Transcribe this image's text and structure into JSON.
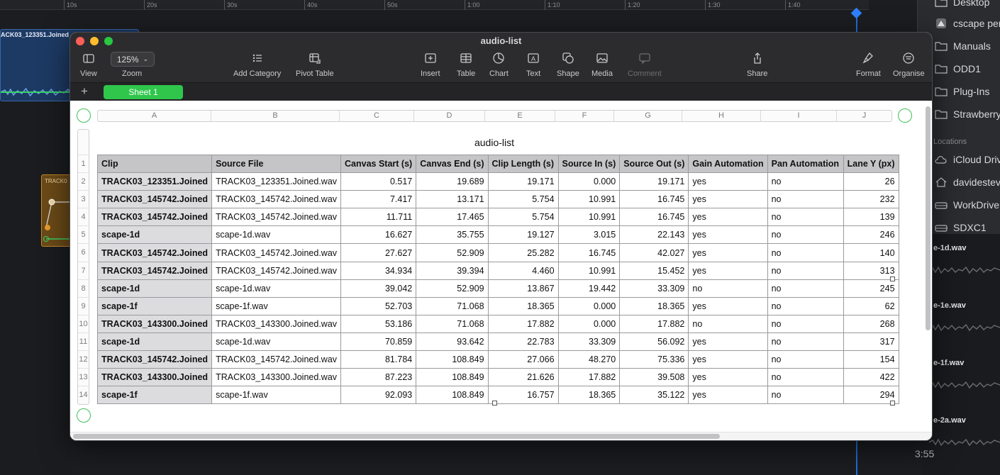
{
  "daw": {
    "ruler_ticks": [
      "10s",
      "20s",
      "30s",
      "40s",
      "50s",
      "1:00",
      "1:10",
      "1:20",
      "1:30",
      "1:40"
    ],
    "clip_name": "ACK03_123351.Joined",
    "clip2_name": "TRACK0",
    "time_readout": "3:55",
    "right_tracks": [
      "e-1d.wav",
      "e-1e.wav",
      "e-1f.wav",
      "e-2a.wav"
    ]
  },
  "finder": {
    "items": [
      {
        "label": "Desktop",
        "icon": "folder-icon"
      },
      {
        "label": "cscape per",
        "icon": "app-icon"
      },
      {
        "label": "Manuals",
        "icon": "folder-icon"
      },
      {
        "label": "ODD1",
        "icon": "folder-icon"
      },
      {
        "label": "Plug-Ins",
        "icon": "folder-icon"
      },
      {
        "label": "Strawberry",
        "icon": "folder-icon"
      }
    ],
    "section": "Locations",
    "locations": [
      {
        "label": "iCloud Drive",
        "icon": "cloud-icon"
      },
      {
        "label": "davidesteve",
        "icon": "home-icon"
      },
      {
        "label": "WorkDrive",
        "icon": "drive-icon"
      },
      {
        "label": "SDXC1",
        "icon": "drive-icon"
      }
    ]
  },
  "window": {
    "title": "audio-list",
    "toolbar": {
      "view": "View",
      "zoom_value": "125%",
      "zoom": "Zoom",
      "add_category": "Add Category",
      "pivot_table": "Pivot Table",
      "insert": "Insert",
      "table": "Table",
      "chart": "Chart",
      "text": "Text",
      "shape": "Shape",
      "media": "Media",
      "comment": "Comment",
      "share": "Share",
      "format": "Format",
      "organise": "Organise"
    },
    "add_sheet": "+",
    "sheet_tab": "Sheet 1"
  },
  "sheet": {
    "table_title": "audio-list",
    "column_letters": [
      "A",
      "B",
      "C",
      "D",
      "E",
      "F",
      "G",
      "H",
      "I",
      "J"
    ],
    "row_numbers": [
      "1",
      "2",
      "3",
      "4",
      "5",
      "6",
      "7",
      "8",
      "9",
      "10",
      "11",
      "12",
      "13",
      "14"
    ],
    "headers": [
      "Clip",
      "Source File",
      "Canvas Start (s)",
      "Canvas End (s)",
      "Clip Length (s)",
      "Source In (s)",
      "Source Out (s)",
      "Gain Automation",
      "Pan Automation",
      "Lane Y (px)"
    ],
    "rows": [
      [
        "TRACK03_123351.Joined",
        "TRACK03_123351.Joined.wav",
        "0.517",
        "19.689",
        "19.171",
        "0.000",
        "19.171",
        "yes",
        "no",
        "26"
      ],
      [
        "TRACK03_145742.Joined",
        "TRACK03_145742.Joined.wav",
        "7.417",
        "13.171",
        "5.754",
        "10.991",
        "16.745",
        "yes",
        "no",
        "232"
      ],
      [
        "TRACK03_145742.Joined",
        "TRACK03_145742.Joined.wav",
        "11.711",
        "17.465",
        "5.754",
        "10.991",
        "16.745",
        "yes",
        "no",
        "139"
      ],
      [
        "scape-1d",
        "scape-1d.wav",
        "16.627",
        "35.755",
        "19.127",
        "3.015",
        "22.143",
        "yes",
        "no",
        "246"
      ],
      [
        "TRACK03_145742.Joined",
        "TRACK03_145742.Joined.wav",
        "27.627",
        "52.909",
        "25.282",
        "16.745",
        "42.027",
        "yes",
        "no",
        "140"
      ],
      [
        "TRACK03_145742.Joined",
        "TRACK03_145742.Joined.wav",
        "34.934",
        "39.394",
        "4.460",
        "10.991",
        "15.452",
        "yes",
        "no",
        "313"
      ],
      [
        "scape-1d",
        "scape-1d.wav",
        "39.042",
        "52.909",
        "13.867",
        "19.442",
        "33.309",
        "no",
        "no",
        "245"
      ],
      [
        "scape-1f",
        "scape-1f.wav",
        "52.703",
        "71.068",
        "18.365",
        "0.000",
        "18.365",
        "yes",
        "no",
        "62"
      ],
      [
        "TRACK03_143300.Joined",
        "TRACK03_143300.Joined.wav",
        "53.186",
        "71.068",
        "17.882",
        "0.000",
        "17.882",
        "no",
        "no",
        "268"
      ],
      [
        "scape-1d",
        "scape-1d.wav",
        "70.859",
        "93.642",
        "22.783",
        "33.309",
        "56.092",
        "yes",
        "no",
        "317"
      ],
      [
        "TRACK03_145742.Joined",
        "TRACK03_145742.Joined.wav",
        "81.784",
        "108.849",
        "27.066",
        "48.270",
        "75.336",
        "yes",
        "no",
        "154"
      ],
      [
        "TRACK03_143300.Joined",
        "TRACK03_143300.Joined.wav",
        "87.223",
        "108.849",
        "21.626",
        "17.882",
        "39.508",
        "yes",
        "no",
        "422"
      ],
      [
        "scape-1f",
        "scape-1f.wav",
        "92.093",
        "108.849",
        "16.757",
        "18.365",
        "35.122",
        "yes",
        "no",
        "294"
      ]
    ]
  },
  "colors": {
    "sheet_tab": "#2fc64b",
    "playhead": "#1d6fe0",
    "header_fill": "#c5c5c8",
    "clip_fill": "#dcdcde"
  }
}
